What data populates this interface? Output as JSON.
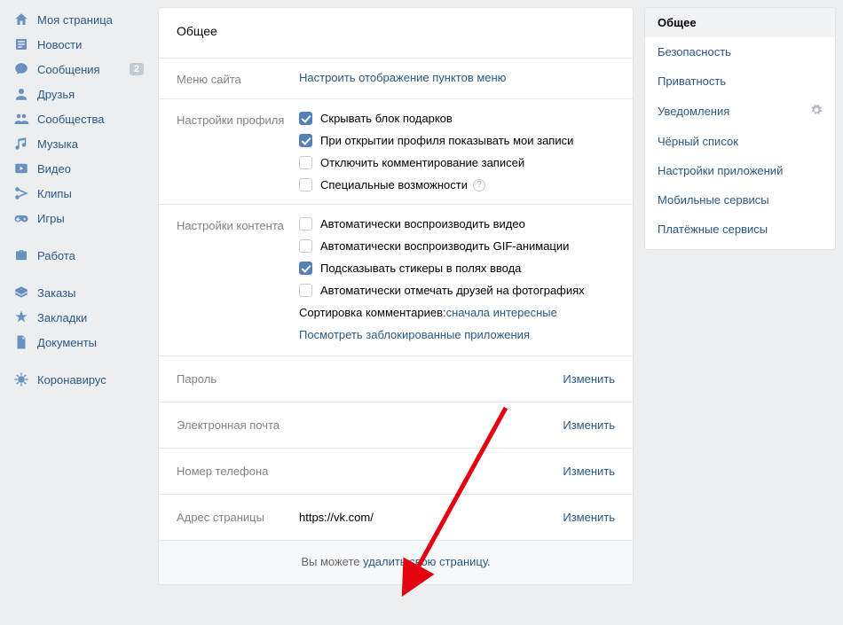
{
  "left_nav": {
    "items": [
      {
        "icon": "home",
        "label": "Моя страница"
      },
      {
        "icon": "news",
        "label": "Новости"
      },
      {
        "icon": "messages",
        "label": "Сообщения",
        "badge": "2"
      },
      {
        "icon": "friend",
        "label": "Друзья"
      },
      {
        "icon": "groups",
        "label": "Сообщества"
      },
      {
        "icon": "music",
        "label": "Музыка"
      },
      {
        "icon": "video",
        "label": "Видео"
      },
      {
        "icon": "clips",
        "label": "Клипы"
      },
      {
        "icon": "games",
        "label": "Игры"
      }
    ],
    "items2": [
      {
        "icon": "work",
        "label": "Работа"
      }
    ],
    "items3": [
      {
        "icon": "orders",
        "label": "Заказы"
      },
      {
        "icon": "bookmarks",
        "label": "Закладки"
      },
      {
        "icon": "docs",
        "label": "Документы"
      }
    ],
    "items4": [
      {
        "icon": "corona",
        "label": "Коронавирус"
      }
    ]
  },
  "main": {
    "title": "Общее",
    "menu": {
      "label": "Меню сайта",
      "link": "Настроить отображение пунктов меню"
    },
    "profile": {
      "label": "Настройки профиля",
      "opts": [
        {
          "checked": true,
          "text": "Скрывать блок подарков"
        },
        {
          "checked": true,
          "text": "При открытии профиля показывать мои записи"
        },
        {
          "checked": false,
          "text": "Отключить комментирование записей"
        },
        {
          "checked": false,
          "text": "Специальные возможности",
          "help": true
        }
      ]
    },
    "content": {
      "label": "Настройки контента",
      "opts": [
        {
          "checked": false,
          "text": "Автоматически воспроизводить видео"
        },
        {
          "checked": false,
          "text": "Автоматически воспроизводить GIF-анимации"
        },
        {
          "checked": true,
          "text": "Подсказывать стикеры в полях ввода"
        },
        {
          "checked": false,
          "text": "Автоматически отмечать друзей на фотографиях"
        }
      ],
      "sort_label": "Сортировка комментариев: ",
      "sort_value": "сначала интересные",
      "blocked_apps": "Посмотреть заблокированные приложения"
    },
    "password": {
      "label": "Пароль",
      "value": "",
      "action": "Изменить"
    },
    "email": {
      "label": "Электронная почта",
      "value": "",
      "action": "Изменить"
    },
    "phone": {
      "label": "Номер телефона",
      "value": "",
      "action": "Изменить"
    },
    "page_addr": {
      "label": "Адрес страницы",
      "value": "https://vk.com/",
      "action": "Изменить"
    },
    "footer": {
      "prefix": "Вы можете ",
      "link": "удалить свою страницу."
    }
  },
  "right_nav": {
    "items": [
      {
        "label": "Общее",
        "active": true
      },
      {
        "label": "Безопасность"
      },
      {
        "label": "Приватность"
      },
      {
        "label": "Уведомления",
        "gear": true
      },
      {
        "label": "Чёрный список"
      },
      {
        "label": "Настройки приложений"
      },
      {
        "label": "Мобильные сервисы"
      },
      {
        "label": "Платёжные сервисы"
      }
    ]
  }
}
